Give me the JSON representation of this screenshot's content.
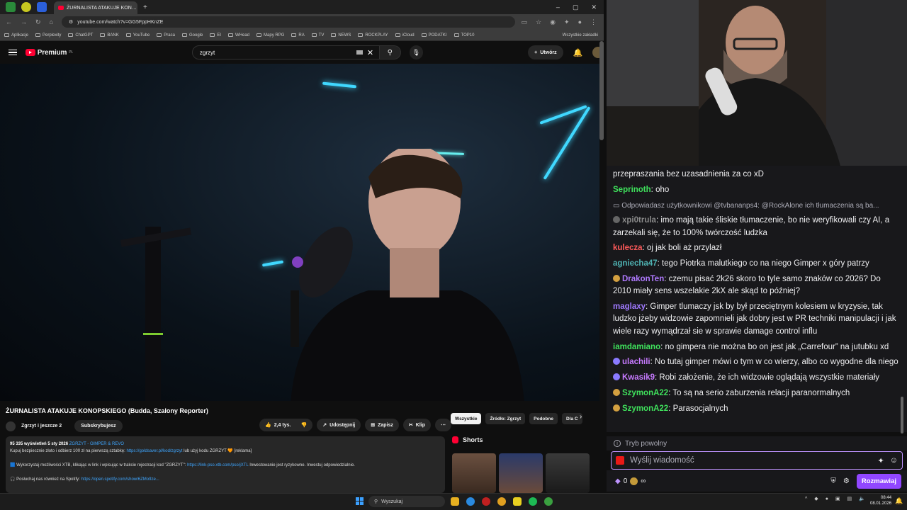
{
  "browser": {
    "active_tab_title": "ŻURNALISTA ATAKUJE KON…",
    "url": "youtube.com/watch?v=GG5FppHKnZE",
    "bookmarks": [
      "Aplikacje",
      "Perplexity",
      "ChatGPT",
      "BANK",
      "YouTube",
      "Praca",
      "Google",
      "EI",
      "WHead",
      "Mapy RPG",
      "RA",
      "TV",
      "NEWS",
      "ROCKPLAY",
      "iCloud",
      "PODATKI",
      "TOP10"
    ],
    "all_bookmarks_label": "Wszystkie zakładki"
  },
  "youtube": {
    "logo_text": "Premium",
    "logo_country": "PL",
    "search_value": "zgrzyt",
    "create_label": "Utwórz",
    "video_title": "ŻURNALISTA ATAKUJE KONOPSKIEGO (Budda, Szalony Reporter)",
    "channel_name": "Zgrzyt i jeszcze 2",
    "subscribe_label": "Subskrybujesz",
    "likes": "2,4 tys.",
    "share_label": "Udostępnij",
    "save_label": "Zapisz",
    "clip_label": "Klip",
    "description": {
      "meta": "95 335 wyświetleń  5 sty 2026",
      "tags": "ZGRZYT - GIMPER & REVO",
      "line1_text": "Kupuj bezpiecznie złoto i odbierz 100 zł na pierwszą sztabkę:",
      "line1_link": "https://goldsaver.pl/kod/zgrzyt",
      "line1_tail": "lub użyj kodu ZGRZYT 🧡 [reklama]",
      "line2_text": "🟦 Wykorzystaj możliwości XTB, klikając w link i wpisując w trakcie rejestracji kod \"ZGRZYT\":",
      "line2_link": "https://link-pso.xtb.com/pso/jXTL",
      "line2_tail": "Inwestowanie jest ryzykowne. Inwestuj odpowiedzialnie.",
      "line3_text": "🎧 Posłuchaj nas również na Spotify:",
      "line3_link": "https://open.spotify.com/show/6ZMo9ze..."
    },
    "chips": [
      "Wszystkie",
      "Źródło: Zgrzyt",
      "Podobne",
      "Dla C"
    ],
    "shorts_label": "Shorts"
  },
  "chat": {
    "messages": [
      {
        "user": "",
        "color": "#efeff1",
        "text": "przepraszania bez uzasadnienia za co xD"
      },
      {
        "user": "Seprinoth",
        "color": "#3fe25c",
        "text": "oho"
      },
      {
        "reply": "Odpowiadasz użytkownikowi @tvbananps4: @RockAlone ich tłumaczenia są ba..."
      },
      {
        "user": "xpi0trula",
        "color": "#8a8a8a",
        "badge": "#666666",
        "text": "imo mają takie śliskie tłumaczenie, bo nie weryfikowali czy AI, a zarzekali się, że to 100% twórczość ludzka"
      },
      {
        "user": "kulecza",
        "color": "#ff5a5a",
        "text": "oj jak boli aż przylazł"
      },
      {
        "user": "agniecha47",
        "color": "#4fb3b3",
        "text": "tego Piotrka malutkiego co na niego Gimper x góry patrzy"
      },
      {
        "user": "DrakonTen",
        "color": "#b07aff",
        "badge": "#d4a040",
        "text": "czemu pisać 2k26 skoro to tyle samo znaków co 2026? Do 2010 miały sens wszelakie 2kX ale skąd to później?"
      },
      {
        "user": "maglaxy",
        "color": "#a07aff",
        "text": "Gimper tlumaczy jsk by był przeciętnym kolesiem w kryzysie, tak ludzko jżeby widzowie zapomnieli jak dobry jest w PR techniki manipulacji i jak wiele razy wymądrzał sie w sprawie damage control influ"
      },
      {
        "user": "iamdamiano",
        "color": "#3fe25c",
        "text": "no gimpera nie można bo on jest jak „Carrefour” na jutubku xd"
      },
      {
        "user": "ulachili",
        "color": "#c77aff",
        "badge": "#8a7aff",
        "text": "No tutaj gimper mówi o tym w co wierzy, albo co wygodne dla niego"
      },
      {
        "user": "Kwasik9",
        "color": "#c77aff",
        "badge": "#8a7aff",
        "text": "Robi założenie, że ich widzowie oglądają wszystkie materiały"
      },
      {
        "user": "SzymonA22",
        "color": "#3fe25c",
        "badge": "#d4a040",
        "text": "To są na serio zaburzenia relacji paranormalnych"
      },
      {
        "user": "SzymonA22",
        "color": "#3fe25c",
        "badge": "#d4a040",
        "text": "Parasocjalnych"
      }
    ],
    "slow_mode": "Tryb powolny",
    "input_placeholder": "Wyślij wiadomość",
    "points": "0",
    "points_inf": "∞",
    "chat_button": "Rozmawiaj"
  },
  "taskbar": {
    "search_label": "Wyszukaj",
    "time": "08:44",
    "date": "08.01.2026"
  },
  "colors": {
    "yt_red": "#ff0033",
    "twitch_purple": "#9147ff"
  }
}
